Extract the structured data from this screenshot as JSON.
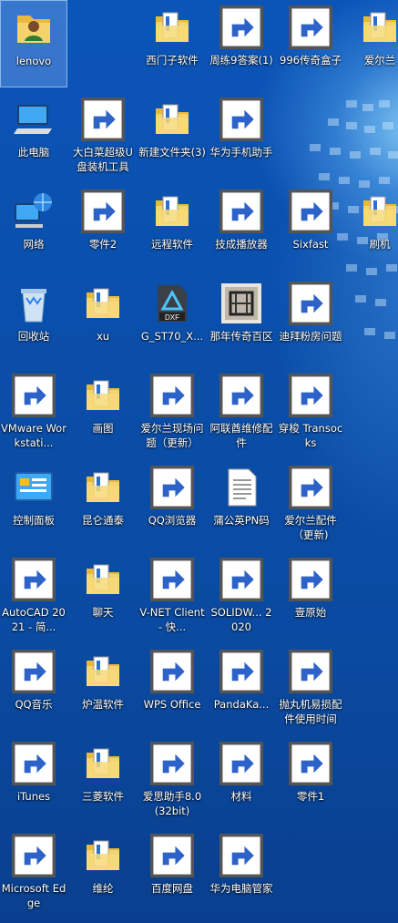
{
  "desktop": {
    "icons": [
      {
        "label": "lenovo",
        "icon": "user-folder-icon",
        "shortcut": false,
        "selected": true
      },
      {
        "label": "西门子软件",
        "icon": "folder-icon",
        "shortcut": false
      },
      {
        "label": "周练9答案(1)",
        "icon": "wps-writer-icon",
        "shortcut": true
      },
      {
        "label": "996传奇盒子",
        "icon": "dragon-game-icon",
        "shortcut": true
      },
      {
        "label": "爱尔兰",
        "icon": "folder-icon",
        "shortcut": false
      },
      {
        "label": "此电脑",
        "icon": "computer-icon",
        "shortcut": false
      },
      {
        "label": "大白菜超级U盘装机工具",
        "icon": "cabbage-tool-icon",
        "shortcut": true
      },
      {
        "label": "新建文件夹(3)",
        "icon": "folder-icon",
        "shortcut": false
      },
      {
        "label": "华为手机助手",
        "icon": "huawei-hisuite-icon",
        "shortcut": true
      },
      {
        "label": "网络",
        "icon": "network-icon",
        "shortcut": false
      },
      {
        "label": "零件2",
        "icon": "solidworks-part-icon",
        "shortcut": true
      },
      {
        "label": "远程软件",
        "icon": "folder-icon",
        "shortcut": false
      },
      {
        "label": "技成播放器",
        "icon": "player-icon",
        "shortcut": true
      },
      {
        "label": "Sixfast",
        "icon": "sixfast-icon",
        "shortcut": true
      },
      {
        "label": "刷机",
        "icon": "folder-icon",
        "shortcut": false
      },
      {
        "label": "回收站",
        "icon": "recycle-bin-icon",
        "shortcut": false
      },
      {
        "label": "xu",
        "icon": "folder-icon",
        "shortcut": false
      },
      {
        "label": "G_ST70_X...",
        "icon": "dxf-file-icon",
        "shortcut": false
      },
      {
        "label": "那年传奇百区",
        "icon": "game-banner-icon",
        "shortcut": false
      },
      {
        "label": "迪拜粉房问题",
        "icon": "wps-writer-icon",
        "shortcut": true
      },
      {
        "label": "VMware Workstati...",
        "icon": "vmware-icon",
        "shortcut": true
      },
      {
        "label": "画图",
        "icon": "folder-icon",
        "shortcut": false
      },
      {
        "label": "爱尔兰现场问题（更新）",
        "icon": "wps-writer-icon",
        "shortcut": true
      },
      {
        "label": "阿联酋维修配件",
        "icon": "wps-sheet-icon",
        "shortcut": true
      },
      {
        "label": "穿梭 Transocks",
        "icon": "transocks-icon",
        "shortcut": true
      },
      {
        "label": "控制面板",
        "icon": "control-panel-icon",
        "shortcut": false
      },
      {
        "label": "昆仑通泰",
        "icon": "folder-icon",
        "shortcut": false
      },
      {
        "label": "QQ浏览器",
        "icon": "qq-browser-icon",
        "shortcut": true
      },
      {
        "label": "蒲公英PN码",
        "icon": "text-file-icon",
        "shortcut": false
      },
      {
        "label": "爱尔兰配件（更新)",
        "icon": "wps-sheet-icon",
        "shortcut": true
      },
      {
        "label": "AutoCAD 2021 - 简...",
        "icon": "autocad-icon",
        "shortcut": true
      },
      {
        "label": "聊天",
        "icon": "folder-icon",
        "shortcut": false
      },
      {
        "label": "V-NET Client - 快...",
        "icon": "cloud-icon",
        "shortcut": true
      },
      {
        "label": "SOLIDW... 2020",
        "icon": "solidworks-icon",
        "shortcut": true
      },
      {
        "label": "壹原始",
        "icon": "game-banner-icon",
        "shortcut": true
      },
      {
        "label": "QQ音乐",
        "icon": "qq-music-icon",
        "shortcut": true
      },
      {
        "label": "炉温软件",
        "icon": "folder-icon",
        "shortcut": false
      },
      {
        "label": "WPS Office",
        "icon": "wps-office-icon",
        "shortcut": true
      },
      {
        "label": "PandaKa...",
        "icon": "panda-icon",
        "shortcut": true
      },
      {
        "label": "抛丸机易损配件使用时间",
        "icon": "wps-sheet-icon",
        "shortcut": true
      },
      {
        "label": "iTunes",
        "icon": "itunes-icon",
        "shortcut": true
      },
      {
        "label": "三菱软件",
        "icon": "folder-icon",
        "shortcut": false
      },
      {
        "label": "爱思助手8.0(32bit)",
        "icon": "i4-icon",
        "shortcut": true
      },
      {
        "label": "材料",
        "icon": "wps-sheet-icon",
        "shortcut": true
      },
      {
        "label": "零件1",
        "icon": "solidworks-part-icon",
        "shortcut": true
      },
      {
        "label": "Microsoft Edge",
        "icon": "edge-icon",
        "shortcut": true
      },
      {
        "label": "维纶",
        "icon": "folder-icon",
        "shortcut": false
      },
      {
        "label": "百度网盘",
        "icon": "baidu-netdisk-icon",
        "shortcut": true
      },
      {
        "label": "华为电脑管家",
        "icon": "huawei-pc-manager-icon",
        "shortcut": true
      }
    ]
  }
}
